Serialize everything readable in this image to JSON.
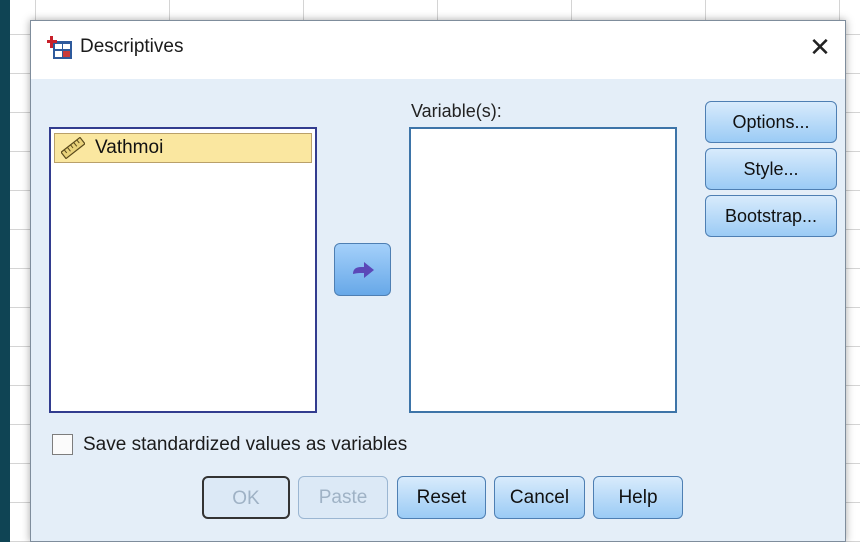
{
  "dialog": {
    "title": "Descriptives",
    "close_glyph": "✕"
  },
  "source_list": {
    "items": [
      {
        "label": "Vathmoi",
        "icon": "scale-measure-icon"
      }
    ]
  },
  "target_list": {
    "label": "Variable(s):",
    "items": []
  },
  "move_button": {
    "icon": "arrow-right-icon"
  },
  "side_buttons": {
    "options": "Options...",
    "style": "Style...",
    "bootstrap": "Bootstrap..."
  },
  "checkbox": {
    "label": "Save standardized values as variables",
    "checked": false
  },
  "buttons": {
    "ok": "OK",
    "paste": "Paste",
    "reset": "Reset",
    "cancel": "Cancel",
    "help": "Help"
  },
  "colors": {
    "dialog_bg": "#e4eef8",
    "button_blue": "#9bcbf5",
    "selected_item": "#fae7a0",
    "desktop": "#0f4454"
  }
}
